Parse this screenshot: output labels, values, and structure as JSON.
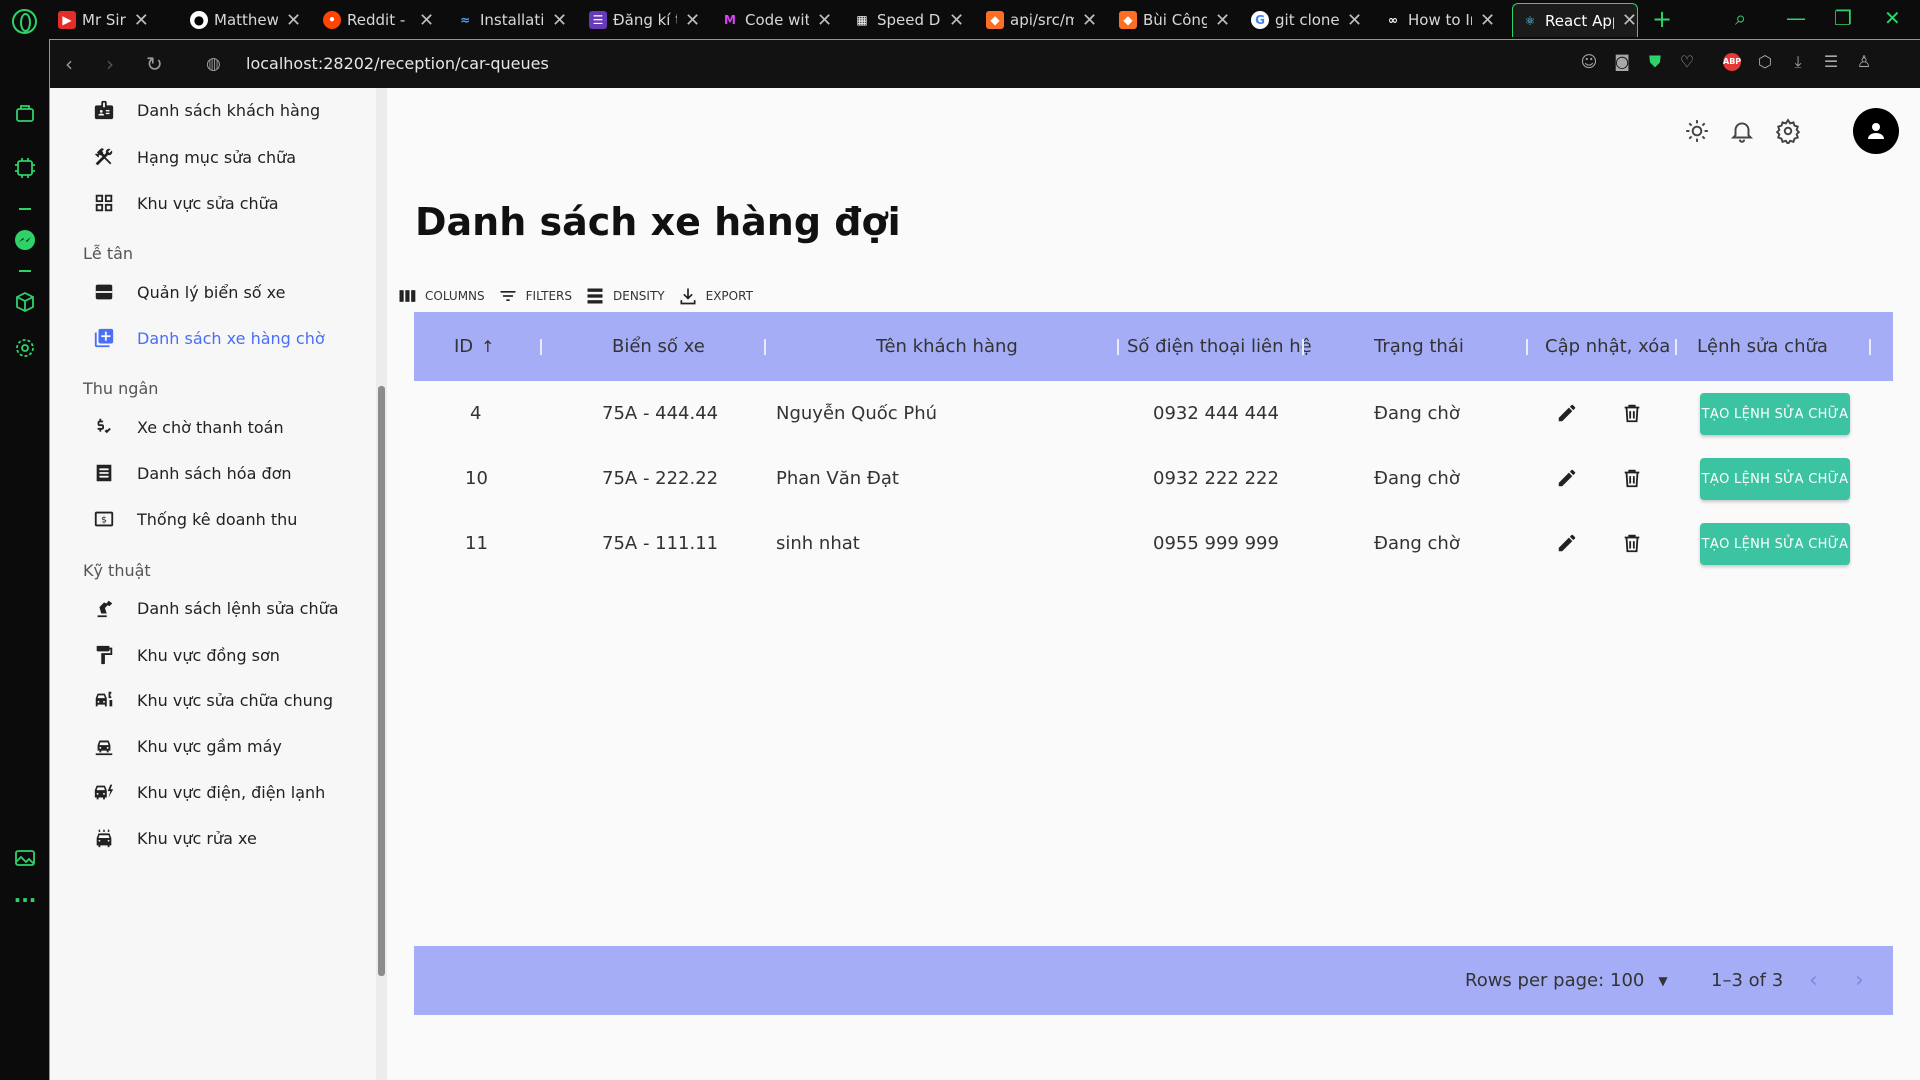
{
  "browser": {
    "tabs": [
      {
        "title": "Mr Sir",
        "icon": "youtube-icon"
      },
      {
        "title": "MatthewF",
        "icon": "github-icon"
      },
      {
        "title": "Reddit - D",
        "icon": "reddit-icon"
      },
      {
        "title": "Installatio",
        "icon": "installation-icon"
      },
      {
        "title": "Đăng kí t",
        "icon": "form-icon"
      },
      {
        "title": "Code with",
        "icon": "code-icon"
      },
      {
        "title": "Speed Di",
        "icon": "speed-dial-icon"
      },
      {
        "title": "api/src/m",
        "icon": "gitlab-icon"
      },
      {
        "title": "Bùi Công",
        "icon": "gitlab-icon"
      },
      {
        "title": "git clone",
        "icon": "google-icon"
      },
      {
        "title": "How to In",
        "icon": "link-icon"
      },
      {
        "title": "React App",
        "icon": "react-icon"
      }
    ],
    "url": "localhost:28202/reception/car-queues",
    "accent": "#2fd26a"
  },
  "nav": {
    "items_top": [
      {
        "label": "Danh sách khách hàng",
        "icon": "customer-badge-icon"
      },
      {
        "label": "Hạng mục sửa chữa",
        "icon": "tools-icon"
      },
      {
        "label": "Khu vực sửa chữa",
        "icon": "grid-icon"
      }
    ],
    "section_reception": "Lễ tân",
    "items_reception": [
      {
        "label": "Quản lý biển số xe",
        "icon": "plate-icon"
      },
      {
        "label": "Danh sách xe hàng chờ",
        "icon": "add-box-icon",
        "active": true
      }
    ],
    "section_cashier": "Thu ngân",
    "items_cashier": [
      {
        "label": "Xe chờ thanh toán",
        "icon": "price-icon"
      },
      {
        "label": "Danh sách hóa đơn",
        "icon": "list-icon"
      },
      {
        "label": "Thống kê doanh thu",
        "icon": "money-icon"
      }
    ],
    "section_tech": "Kỹ thuật",
    "items_tech": [
      {
        "label": "Danh sách lệnh sửa chữa",
        "icon": "robot-arm-icon"
      },
      {
        "label": "Khu vực đồng sơn",
        "icon": "paint-roller-icon"
      },
      {
        "label": "Khu vực sửa chữa chung",
        "icon": "car-repair-icon"
      },
      {
        "label": "Khu vực gầm máy",
        "icon": "car-under-icon"
      },
      {
        "label": "Khu vực điện, điện lạnh",
        "icon": "car-electric-icon"
      },
      {
        "label": "Khu vực rửa xe",
        "icon": "car-wash-icon"
      }
    ],
    "active_color": "#4a6ef5"
  },
  "page": {
    "title": "Danh sách xe hàng đợi"
  },
  "toolbar": {
    "columns": "COLUMNS",
    "filters": "FILTERS",
    "density": "DENSITY",
    "export": "EXPORT"
  },
  "table": {
    "headers": [
      "ID",
      "Biển số xe",
      "Tên khách hàng",
      "Số điện thoại liên hệ",
      "Trạng thái",
      "Cập nhật, xóa",
      "Lệnh sửa chữa"
    ],
    "rows": [
      {
        "id": "4",
        "plate": "75A - 444.44",
        "name": "Nguyễn Quốc Phú",
        "phone": "0932 444 444",
        "status": "Đang chờ",
        "action": "TẠO LỆNH SỬA CHỮA"
      },
      {
        "id": "10",
        "plate": "75A - 222.22",
        "name": "Phan Văn Đạt",
        "phone": "0932 222 222",
        "status": "Đang chờ",
        "action": "TẠO LỆNH SỬA CHỮA"
      },
      {
        "id": "11",
        "plate": "75A - 111.11",
        "name": "sinh nhat",
        "phone": "0955 999 999",
        "status": "Đang chờ",
        "action": "TẠO LỆNH SỬA CHỮA"
      }
    ],
    "header_color": "#a5adf7",
    "button_color": "#3cc4a2"
  },
  "footer": {
    "rows_per_page_label": "Rows per page:",
    "rows_per_page_value": "100",
    "range": "1–3 of 3"
  }
}
